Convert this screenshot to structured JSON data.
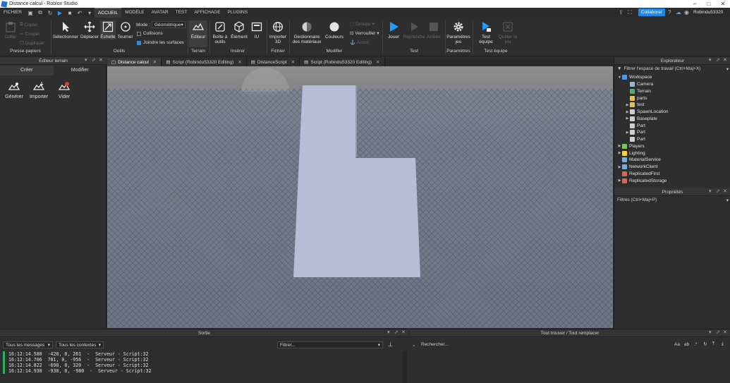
{
  "window": {
    "title": "Distance calcul - Roblox Studio",
    "min_glyph": "–",
    "max_glyph": "□",
    "close_glyph": "✕"
  },
  "menubar": {
    "file": "FICHIER",
    "tabs": [
      "ACCUEIL",
      "MODÈLE",
      "AVATAR",
      "TEST",
      "AFFICHAGE",
      "PLUGINS"
    ],
    "collaborate": "Collaborer",
    "username": "Robindu53320",
    "accent": "#00a2ff"
  },
  "ribbon": {
    "clipboard": {
      "paste": "Coller",
      "copy": "Copier",
      "cut": "Couper",
      "duplicate": "Dupliquer",
      "label": "Presse-papiers"
    },
    "tools": {
      "select": "Sélectionner",
      "move": "Déplacer",
      "scale": "Échelle",
      "rotate": "Tourner",
      "mode_label": "Mode :",
      "mode_value": "Géométrique",
      "collisions": "Collisions",
      "join": "Joindre les surfaces",
      "label": "Outils"
    },
    "terrain": {
      "editor": "Éditeur",
      "label": "Terrain"
    },
    "insert": {
      "toolbox": "Boîte à outils",
      "element": "Élément",
      "ui": "IU",
      "label": "Insérer"
    },
    "file": {
      "import3d": "Importer 3D",
      "label": "Fichier"
    },
    "edit": {
      "materials": "Gestionnaire des matériaux",
      "colors": "Couleurs",
      "group": "Groupe",
      "lock": "Verrouiller",
      "anchor": "Ancré",
      "label": "Modifier"
    },
    "test": {
      "play": "Jouer",
      "resume": "Reprendre",
      "stop": "Arrêter",
      "label": "Test"
    },
    "settings": {
      "game_settings": "Paramètres jeu",
      "label": "Paramètres"
    },
    "team_test": {
      "team_test": "Test équipe",
      "quit": "Quitter le jeu",
      "label": "Test équipe"
    }
  },
  "terrain_editor": {
    "title": "Éditeur terrain",
    "tabs": [
      "Créer",
      "Modifier"
    ],
    "tools": [
      "Générer",
      "Importer",
      "Vider"
    ]
  },
  "doc_tabs": [
    {
      "label": "Distance calcul",
      "active": true
    },
    {
      "label": "Script (Robindu53320 Editing)",
      "active": false
    },
    {
      "label": "DistanceScript",
      "active": false
    },
    {
      "label": "Script (Robindu53320 Editing)",
      "active": false
    }
  ],
  "explorer": {
    "title": "Explorateur",
    "filter_placeholder": "Filtrer l'espace de travail (Ctrl+Maj+X)",
    "items": [
      {
        "label": "Workspace",
        "icon": "workspace-icon",
        "color": "#4d9ae0",
        "arrow": "▼"
      },
      {
        "label": "Camera",
        "icon": "camera-icon",
        "color": "#9ab7cc",
        "arrow": ""
      },
      {
        "label": "Terrain",
        "icon": "terrain-icon",
        "color": "#4fae6a",
        "arrow": ""
      },
      {
        "label": "parts",
        "icon": "folder-icon",
        "color": "#e7c24a",
        "arrow": ""
      },
      {
        "label": "test",
        "icon": "folder-icon",
        "color": "#e7c24a",
        "arrow": "▶"
      },
      {
        "label": "SpawnLocation",
        "icon": "spawn-icon",
        "color": "#cfcfcf",
        "arrow": "▶"
      },
      {
        "label": "Baseplate",
        "icon": "part-icon",
        "color": "#cfcfcf",
        "arrow": "▶"
      },
      {
        "label": "Part",
        "icon": "part-icon",
        "color": "#cfcfcf",
        "arrow": ""
      },
      {
        "label": "Part",
        "icon": "part-icon",
        "color": "#cfcfcf",
        "arrow": "▶"
      },
      {
        "label": "Part",
        "icon": "part-icon",
        "color": "#cfcfcf",
        "arrow": ""
      },
      {
        "label": "Players",
        "icon": "players-icon",
        "color": "#7ec45a",
        "arrow": "▶"
      },
      {
        "label": "Lighting",
        "icon": "lighting-icon",
        "color": "#f0d24a",
        "arrow": "▶"
      },
      {
        "label": "MaterialService",
        "icon": "material-icon",
        "color": "#6fb0e0",
        "arrow": ""
      },
      {
        "label": "NetworkClient",
        "icon": "network-icon",
        "color": "#6fb0e0",
        "arrow": "▶"
      },
      {
        "label": "ReplicatedFirst",
        "icon": "replicated-icon",
        "color": "#d06a5a",
        "arrow": ""
      },
      {
        "label": "ReplicatedStorage",
        "icon": "replicated-icon",
        "color": "#d06a5a",
        "arrow": "▶"
      }
    ]
  },
  "properties": {
    "title": "Propriétés",
    "filter_placeholder": "Filtres (Ctrl+Maj+P)"
  },
  "output": {
    "title": "Sortie",
    "messages_filter": "Tous les messages",
    "contexts_filter": "Tous les contextes",
    "filter_placeholder": "Filtrer...",
    "lines": [
      "16:12:14.588  -420, 0, 261  -  Serveur - Script:32",
      "16:12:14.706  781, 0, -956  -  Serveur - Script:32",
      "16:12:14.822  -698, 0, 320  -  Serveur - Script:32",
      "16:12:14.938  -938, 0, -980  -  Serveur - Script:32"
    ]
  },
  "find_replace": {
    "title": "Tout trouver / Tout remplacer",
    "search_placeholder": "Rechercher...",
    "opt_case": "Aa",
    "opt_word": "ab",
    "opt_regex": ".*"
  }
}
